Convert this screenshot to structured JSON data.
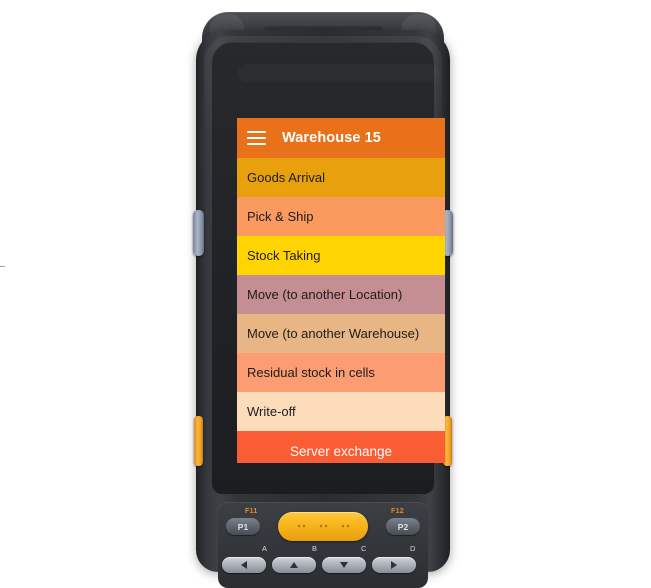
{
  "screen": {
    "appbar": {
      "menu_icon": "hamburger-icon",
      "title": "Warehouse 15",
      "background": "#e8711a",
      "text_color": "#ffffff"
    },
    "menu_items": [
      {
        "label": "Goods Arrival",
        "background": "#e8a00c",
        "text_color": "#1d1d1d"
      },
      {
        "label": "Pick & Ship",
        "background": "#fa9a5e",
        "text_color": "#1d1d1d"
      },
      {
        "label": "Stock Taking",
        "background": "#ffd400",
        "text_color": "#1d1d1d"
      },
      {
        "label": "Move (to another Location)",
        "background": "#c48e93",
        "text_color": "#1d1d1d"
      },
      {
        "label": "Move (to another Warehouse)",
        "background": "#e8b684",
        "text_color": "#1d1d1d"
      },
      {
        "label": "Residual stock in cells",
        "background": "#fb9c72",
        "text_color": "#1d1d1d"
      },
      {
        "label": "Write-off",
        "background": "#fcdcba",
        "text_color": "#1d1d1d"
      }
    ],
    "action_button": {
      "label": "Server exchange",
      "background": "#fa5c33",
      "text_color": "#ffffff"
    }
  },
  "device": {
    "name": "rugged-handheld-terminal",
    "shell_color": "#2b2e31",
    "side_buttons": {
      "scan_left": "scan-button-left",
      "scan_right": "scan-button-right",
      "amber_left": "function-button-left",
      "amber_right": "function-button-right"
    },
    "keypad": {
      "f_labels": {
        "left": "F11",
        "right": "F12"
      },
      "p_keys": {
        "left": "P1",
        "right": "P2"
      },
      "scan_key": "scan-key",
      "arrow_labels": [
        "A",
        "B",
        "C",
        "D"
      ],
      "arrows": [
        "left",
        "up",
        "down",
        "right"
      ],
      "label_color": "#e28c2a"
    }
  }
}
